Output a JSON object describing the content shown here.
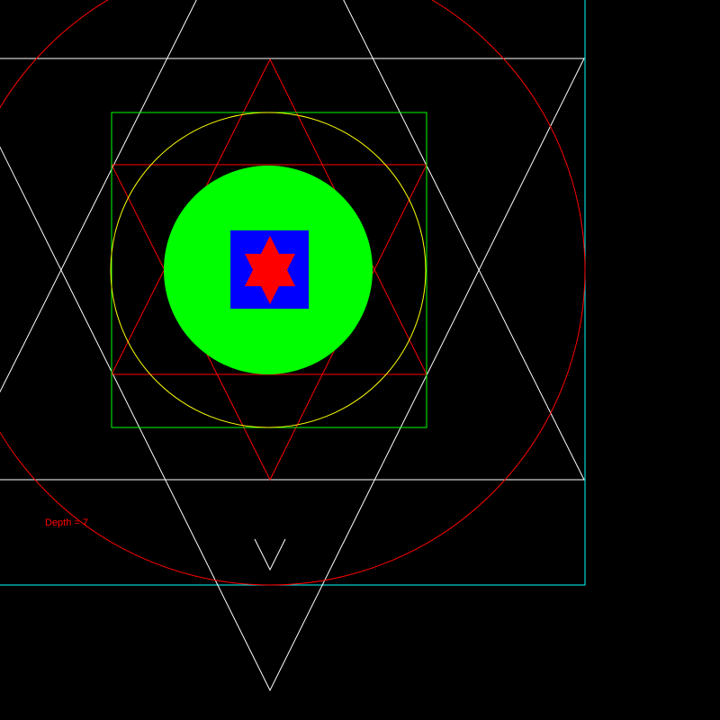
{
  "depth_label": "Depth = 7",
  "colors": {
    "background": "#000000",
    "cyan": "#00ffff",
    "white": "#ffffff",
    "red": "#ff0000",
    "green": "#00ff00",
    "yellow": "#ffff00",
    "blue": "#0000ff"
  },
  "levels": [
    {
      "level": 1,
      "shape": "square",
      "color": "cyan",
      "fill": false
    },
    {
      "level": 2,
      "shape": "hexagram",
      "color": "white",
      "fill": false
    },
    {
      "level": 3,
      "shape": "circle",
      "color": "red",
      "fill": false
    },
    {
      "level": 4,
      "shape": "hexagram",
      "color": "red",
      "fill": false
    },
    {
      "level": 5,
      "shape": "square",
      "color": "green",
      "fill": false
    },
    {
      "level": 6,
      "shape": "circle",
      "color": "yellow",
      "fill": false
    },
    {
      "level": 7,
      "shape": "circle",
      "color": "green",
      "fill": true
    },
    {
      "level": 8,
      "shape": "square",
      "color": "blue",
      "fill": true
    },
    {
      "level": 9,
      "shape": "hexagram",
      "color": "red",
      "fill": true
    }
  ]
}
